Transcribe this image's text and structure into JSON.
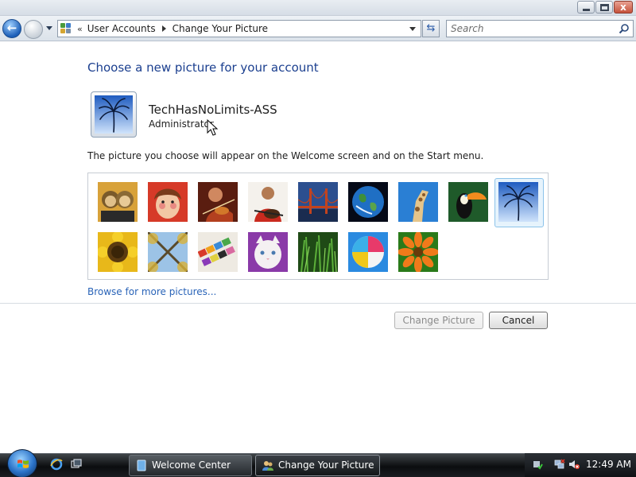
{
  "window": {
    "caption_buttons": [
      "minimize-icon",
      "maximize-icon",
      "close-icon"
    ],
    "close_glyph": "x"
  },
  "nav": {
    "back_icon": "back-arrow-icon",
    "forward_icon": "forward-arrow-icon",
    "crumb_prefix": "«",
    "breadcrumbs": [
      "User Accounts",
      "Change Your Picture"
    ],
    "refresh_icon": "refresh-icon",
    "search_placeholder": "Search"
  },
  "content": {
    "title": "Choose a new picture for your account",
    "user_name": "TechHasNoLimits-ASS",
    "user_role": "Administrator",
    "description": "The picture you choose will appear on the Welcome screen and on the Start menu.",
    "browse_link": "Browse for more pictures...",
    "pictures": [
      "monkeys",
      "girl-face",
      "violinist",
      "guitarist",
      "bridge",
      "earth",
      "giraffe",
      "toucan",
      "palm",
      "sunflower",
      "forest-canopy",
      "paint-palette",
      "cat",
      "grass",
      "beach-ball",
      "orange-flower"
    ],
    "selected_picture": "palm"
  },
  "buttons": {
    "change_picture": "Change Picture",
    "cancel": "Cancel"
  },
  "taskbar": {
    "tasks": [
      "Welcome Center",
      "Change Your Picture"
    ],
    "active_task": "Change Your Picture",
    "clock": "12:49 AM"
  },
  "colors": {
    "title_blue": "#1b3f8f",
    "link_blue": "#2a64b8",
    "selection": "#e6f3fc"
  }
}
